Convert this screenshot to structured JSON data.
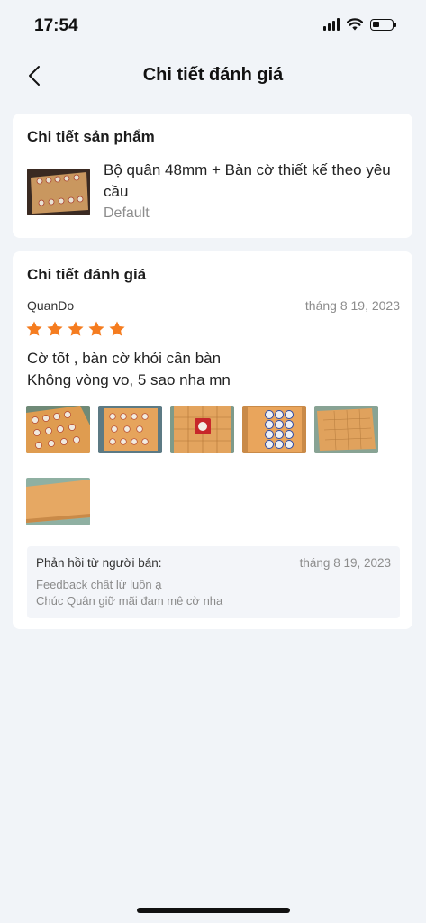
{
  "status_bar": {
    "time": "17:54"
  },
  "nav": {
    "title": "Chi tiết đánh giá"
  },
  "product_section": {
    "heading": "Chi tiết sản phẩm",
    "name": "Bộ quân 48mm + Bàn cờ thiết kế theo yêu cầu",
    "variant": "Default"
  },
  "review_section": {
    "heading": "Chi tiết đánh giá",
    "reviewer": "QuanDo",
    "date": "tháng 8 19, 2023",
    "rating": 5,
    "text": "Cờ tốt , bàn cờ khỏi cần bàn\nKhông vòng vo, 5 sao nha mn",
    "photo_count": 6
  },
  "seller_reply": {
    "label": "Phản hồi từ người bán:",
    "date": "tháng 8 19, 2023",
    "text": "Feedback chất lừ luôn ạ\nChúc Quân giữ mãi đam mê cờ nha"
  },
  "colors": {
    "star": "#f57c1f",
    "background": "#f1f4f8",
    "board_wood": "#e0a35a"
  }
}
